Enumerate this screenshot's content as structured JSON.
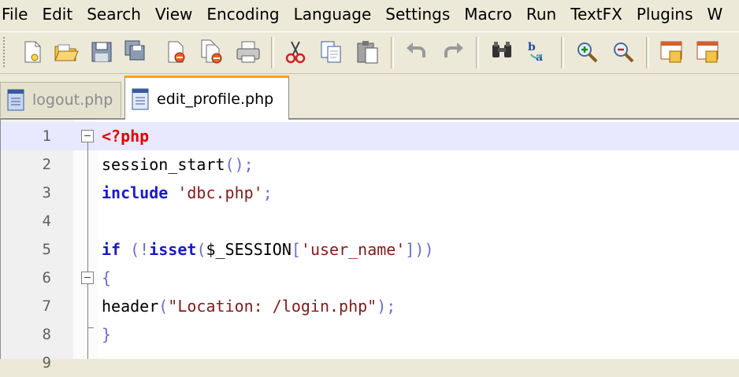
{
  "menu": [
    "File",
    "Edit",
    "Search",
    "View",
    "Encoding",
    "Language",
    "Settings",
    "Macro",
    "Run",
    "TextFX",
    "Plugins",
    "W"
  ],
  "toolbar": {
    "buttons": [
      "new-file-icon",
      "open-file-icon",
      "save-icon",
      "save-all-icon",
      "close-icon",
      "close-all-icon",
      "print-icon",
      "cut-icon",
      "copy-icon",
      "paste-icon",
      "undo-icon",
      "redo-icon",
      "find-icon",
      "replace-icon",
      "zoom-in-icon",
      "zoom-out-icon",
      "sync-vertical-icon",
      "sync-horizontal-icon"
    ]
  },
  "tabs": [
    {
      "label": "logout.php",
      "active": false
    },
    {
      "label": "edit_profile.php",
      "active": true
    }
  ],
  "editor": {
    "current_line": 1,
    "lines": [
      {
        "num": "1",
        "tokens": [
          {
            "t": "<?php",
            "c": "kw-php"
          }
        ]
      },
      {
        "num": "2",
        "tokens": [
          {
            "t": "session_start",
            "c": ""
          },
          {
            "t": "();",
            "c": "op"
          }
        ]
      },
      {
        "num": "3",
        "tokens": [
          {
            "t": "include",
            "c": "kw"
          },
          {
            "t": " ",
            "c": ""
          },
          {
            "t": "'dbc.php'",
            "c": "str"
          },
          {
            "t": ";",
            "c": "op"
          }
        ]
      },
      {
        "num": "4",
        "tokens": []
      },
      {
        "num": "5",
        "tokens": [
          {
            "t": "if",
            "c": "kw"
          },
          {
            "t": " (!",
            "c": "op"
          },
          {
            "t": "isset",
            "c": "kw"
          },
          {
            "t": "(",
            "c": "op"
          },
          {
            "t": "$_SESSION",
            "c": ""
          },
          {
            "t": "[",
            "c": "op"
          },
          {
            "t": "'user_name'",
            "c": "str"
          },
          {
            "t": "]))",
            "c": "op"
          }
        ]
      },
      {
        "num": "6",
        "tokens": [
          {
            "t": "{",
            "c": "op"
          }
        ]
      },
      {
        "num": "7",
        "tokens": [
          {
            "t": "header",
            "c": ""
          },
          {
            "t": "(",
            "c": "op"
          },
          {
            "t": "\"Location: /login.php\"",
            "c": "str"
          },
          {
            "t": ");",
            "c": "op"
          }
        ]
      },
      {
        "num": "8",
        "tokens": [
          {
            "t": "}",
            "c": "op"
          }
        ]
      },
      {
        "num": "9",
        "tokens": []
      }
    ]
  }
}
